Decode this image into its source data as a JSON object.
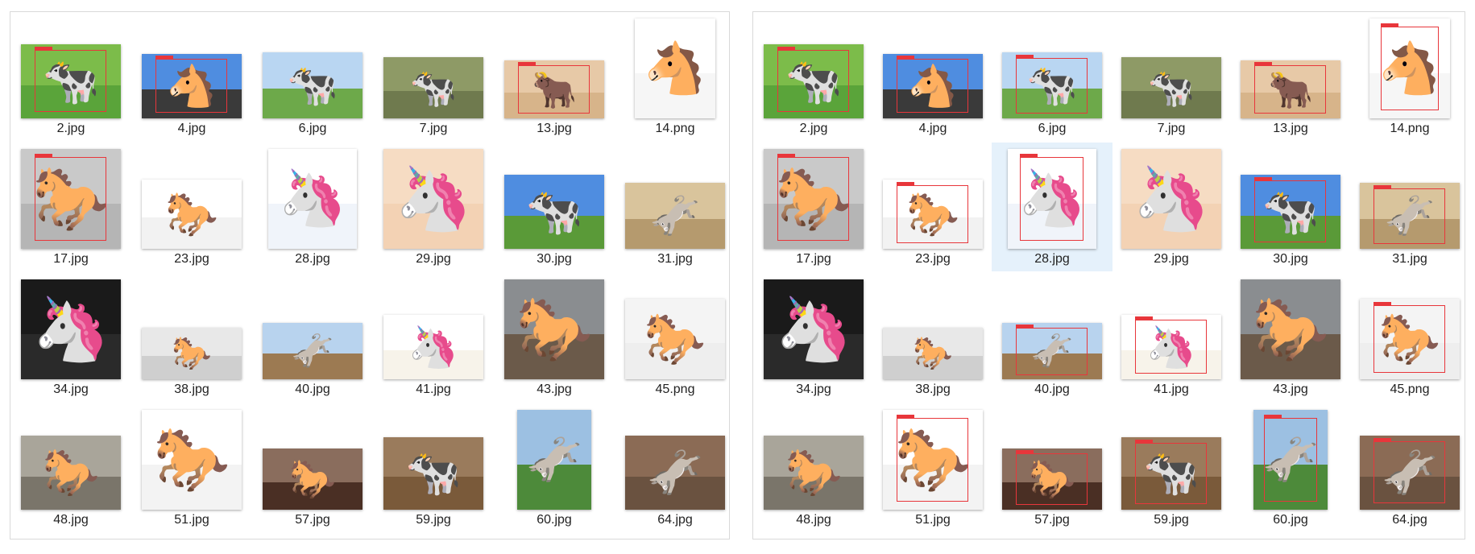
{
  "panels": [
    {
      "id": "left",
      "files": [
        {
          "name": "2.jpg",
          "w": 124,
          "h": 92,
          "sky": "#7cbc4a",
          "ground": "#5aa43a",
          "animal": "🐄",
          "box": true
        },
        {
          "name": "4.jpg",
          "w": 124,
          "h": 80,
          "sky": "#4f8de0",
          "ground": "#3a3a3a",
          "animal": "🐴",
          "box": true
        },
        {
          "name": "6.jpg",
          "w": 124,
          "h": 82,
          "sky": "#b9d6f2",
          "ground": "#6da94a",
          "animal": "🐄",
          "box": false
        },
        {
          "name": "7.jpg",
          "w": 124,
          "h": 76,
          "sky": "#8e9a66",
          "ground": "#6f7a4e",
          "animal": "🐄",
          "box": false
        },
        {
          "name": "13.jpg",
          "w": 124,
          "h": 72,
          "sky": "#e7c9a7",
          "ground": "#d7b48a",
          "animal": "🐂",
          "box": true
        },
        {
          "name": "14.png",
          "w": 100,
          "h": 124,
          "sky": "#ffffff",
          "ground": "#f6f6f6",
          "animal": "🐴",
          "box": false
        },
        {
          "name": "17.jpg",
          "w": 124,
          "h": 124,
          "sky": "#c9c9c9",
          "ground": "#b5b5b5",
          "animal": "🐎",
          "box": true
        },
        {
          "name": "23.jpg",
          "w": 124,
          "h": 86,
          "sky": "#ffffff",
          "ground": "#f2f2f2",
          "animal": "🐎",
          "box": false
        },
        {
          "name": "28.jpg",
          "w": 110,
          "h": 124,
          "sky": "#ffffff",
          "ground": "#f0f4fa",
          "animal": "🦄",
          "box": false
        },
        {
          "name": "29.jpg",
          "w": 124,
          "h": 124,
          "sky": "#f6dcc3",
          "ground": "#f3d2b4",
          "animal": "🦄",
          "box": false
        },
        {
          "name": "30.jpg",
          "w": 124,
          "h": 92,
          "sky": "#4f8de0",
          "ground": "#5a9a38",
          "animal": "🐄",
          "box": false
        },
        {
          "name": "31.jpg",
          "w": 124,
          "h": 82,
          "sky": "#d9c49c",
          "ground": "#b59a6e",
          "animal": "🫏",
          "box": false
        },
        {
          "name": "34.jpg",
          "w": 124,
          "h": 124,
          "sky": "#1a1a1a",
          "ground": "#2a2a2a",
          "animal": "🦄",
          "box": false
        },
        {
          "name": "38.jpg",
          "w": 124,
          "h": 64,
          "sky": "#e8e8e8",
          "ground": "#cfcfcf",
          "animal": "🐎",
          "box": false
        },
        {
          "name": "40.jpg",
          "w": 124,
          "h": 70,
          "sky": "#b8d3ee",
          "ground": "#9c7a52",
          "animal": "🫏",
          "box": false
        },
        {
          "name": "41.jpg",
          "w": 124,
          "h": 80,
          "sky": "#ffffff",
          "ground": "#f7f3ea",
          "animal": "🦄",
          "box": false
        },
        {
          "name": "43.jpg",
          "w": 124,
          "h": 124,
          "sky": "#8a8d90",
          "ground": "#6b5a4a",
          "animal": "🐎",
          "box": false
        },
        {
          "name": "45.png",
          "w": 124,
          "h": 100,
          "sky": "#f4f4f4",
          "ground": "#eeeeee",
          "animal": "🐎",
          "box": false
        },
        {
          "name": "48.jpg",
          "w": 124,
          "h": 92,
          "sky": "#a9a59a",
          "ground": "#7a756a",
          "animal": "🐎",
          "box": false
        },
        {
          "name": "51.jpg",
          "w": 124,
          "h": 124,
          "sky": "#ffffff",
          "ground": "#f3f3f3",
          "animal": "🐎",
          "box": false
        },
        {
          "name": "57.jpg",
          "w": 124,
          "h": 76,
          "sky": "#8a6d5d",
          "ground": "#4a2f24",
          "animal": "🐎",
          "box": false
        },
        {
          "name": "59.jpg",
          "w": 124,
          "h": 90,
          "sky": "#9a7b5c",
          "ground": "#7a5a3a",
          "animal": "🐄",
          "box": false
        },
        {
          "name": "60.jpg",
          "w": 92,
          "h": 124,
          "sky": "#9cc0e2",
          "ground": "#4d8a3a",
          "animal": "🫏",
          "box": false
        },
        {
          "name": "64.jpg",
          "w": 124,
          "h": 92,
          "sky": "#8b6b55",
          "ground": "#6a5240",
          "animal": "🫏",
          "box": false
        }
      ]
    },
    {
      "id": "right",
      "files": [
        {
          "name": "2.jpg",
          "w": 124,
          "h": 92,
          "sky": "#7cbc4a",
          "ground": "#5aa43a",
          "animal": "🐄",
          "box": true
        },
        {
          "name": "4.jpg",
          "w": 124,
          "h": 80,
          "sky": "#4f8de0",
          "ground": "#3a3a3a",
          "animal": "🐴",
          "box": true
        },
        {
          "name": "6.jpg",
          "w": 124,
          "h": 82,
          "sky": "#b9d6f2",
          "ground": "#6da94a",
          "animal": "🐄",
          "box": true
        },
        {
          "name": "7.jpg",
          "w": 124,
          "h": 76,
          "sky": "#8e9a66",
          "ground": "#6f7a4e",
          "animal": "🐄",
          "box": false
        },
        {
          "name": "13.jpg",
          "w": 124,
          "h": 72,
          "sky": "#e7c9a7",
          "ground": "#d7b48a",
          "animal": "🐂",
          "box": true
        },
        {
          "name": "14.png",
          "w": 100,
          "h": 124,
          "sky": "#ffffff",
          "ground": "#f6f6f6",
          "animal": "🐴",
          "box": true
        },
        {
          "name": "17.jpg",
          "w": 124,
          "h": 124,
          "sky": "#c9c9c9",
          "ground": "#b5b5b5",
          "animal": "🐎",
          "box": true
        },
        {
          "name": "23.jpg",
          "w": 124,
          "h": 86,
          "sky": "#ffffff",
          "ground": "#f2f2f2",
          "animal": "🐎",
          "box": true
        },
        {
          "name": "28.jpg",
          "w": 110,
          "h": 124,
          "sky": "#ffffff",
          "ground": "#f0f4fa",
          "animal": "🦄",
          "box": true,
          "selected": true
        },
        {
          "name": "29.jpg",
          "w": 124,
          "h": 124,
          "sky": "#f6dcc3",
          "ground": "#f3d2b4",
          "animal": "🦄",
          "box": false
        },
        {
          "name": "30.jpg",
          "w": 124,
          "h": 92,
          "sky": "#4f8de0",
          "ground": "#5a9a38",
          "animal": "🐄",
          "box": true
        },
        {
          "name": "31.jpg",
          "w": 124,
          "h": 82,
          "sky": "#d9c49c",
          "ground": "#b59a6e",
          "animal": "🫏",
          "box": true
        },
        {
          "name": "34.jpg",
          "w": 124,
          "h": 124,
          "sky": "#1a1a1a",
          "ground": "#2a2a2a",
          "animal": "🦄",
          "box": false
        },
        {
          "name": "38.jpg",
          "w": 124,
          "h": 64,
          "sky": "#e8e8e8",
          "ground": "#cfcfcf",
          "animal": "🐎",
          "box": false
        },
        {
          "name": "40.jpg",
          "w": 124,
          "h": 70,
          "sky": "#b8d3ee",
          "ground": "#9c7a52",
          "animal": "🫏",
          "box": true
        },
        {
          "name": "41.jpg",
          "w": 124,
          "h": 80,
          "sky": "#ffffff",
          "ground": "#f7f3ea",
          "animal": "🦄",
          "box": true
        },
        {
          "name": "43.jpg",
          "w": 124,
          "h": 124,
          "sky": "#8a8d90",
          "ground": "#6b5a4a",
          "animal": "🐎",
          "box": false
        },
        {
          "name": "45.png",
          "w": 124,
          "h": 100,
          "sky": "#f4f4f4",
          "ground": "#eeeeee",
          "animal": "🐎",
          "box": true
        },
        {
          "name": "48.jpg",
          "w": 124,
          "h": 92,
          "sky": "#a9a59a",
          "ground": "#7a756a",
          "animal": "🐎",
          "box": false
        },
        {
          "name": "51.jpg",
          "w": 124,
          "h": 124,
          "sky": "#ffffff",
          "ground": "#f3f3f3",
          "animal": "🐎",
          "box": true
        },
        {
          "name": "57.jpg",
          "w": 124,
          "h": 76,
          "sky": "#8a6d5d",
          "ground": "#4a2f24",
          "animal": "🐎",
          "box": true
        },
        {
          "name": "59.jpg",
          "w": 124,
          "h": 90,
          "sky": "#9a7b5c",
          "ground": "#7a5a3a",
          "animal": "🐄",
          "box": true
        },
        {
          "name": "60.jpg",
          "w": 92,
          "h": 124,
          "sky": "#9cc0e2",
          "ground": "#4d8a3a",
          "animal": "🫏",
          "box": true
        },
        {
          "name": "64.jpg",
          "w": 124,
          "h": 92,
          "sky": "#8b6b55",
          "ground": "#6a5240",
          "animal": "🫏",
          "box": true
        }
      ]
    }
  ],
  "colors": {
    "selection": "#e5f1fb",
    "detection_box": "#e8363b",
    "panel_border": "#d9d9d9"
  }
}
